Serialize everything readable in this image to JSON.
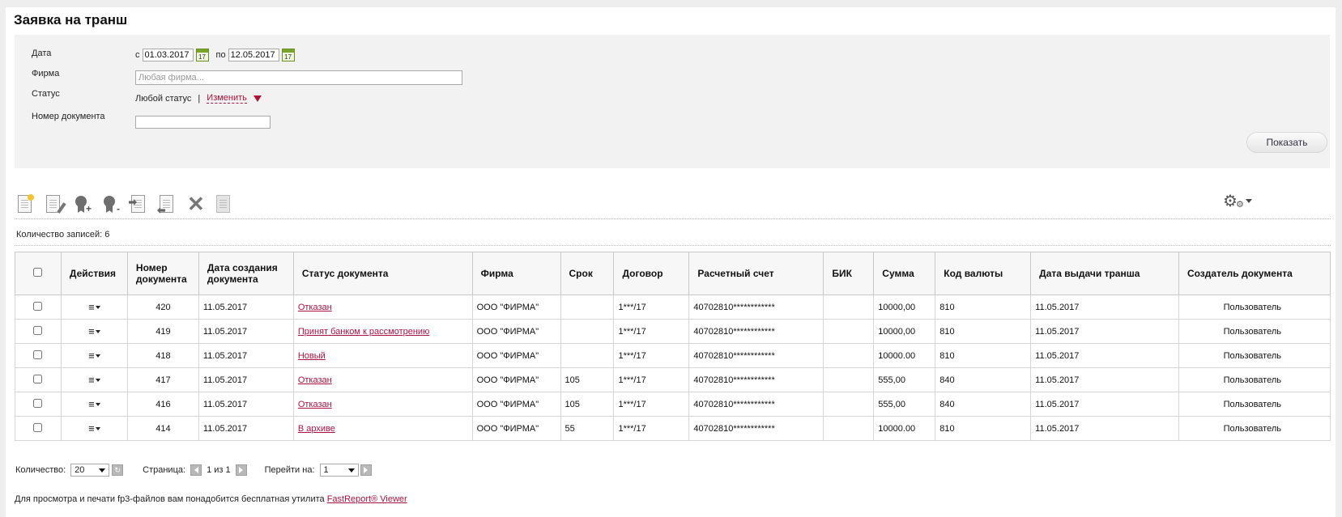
{
  "page": {
    "title": "Заявка на транш"
  },
  "filter": {
    "date_label": "Дата",
    "from_prefix": "с",
    "date_from": "01.03.2017",
    "to_prefix": "по",
    "date_to": "12.05.2017",
    "calendar_day": "17",
    "firm_label": "Фирма",
    "firm_placeholder": "Любая фирма...",
    "status_label": "Статус",
    "status_value": "Любой статус",
    "separator": "|",
    "change_label": "Изменить",
    "docnum_label": "Номер документа",
    "docnum_value": "",
    "show_button": "Показать"
  },
  "toolbar": {
    "icons": [
      "new-document-icon",
      "edit-document-icon",
      "sign-add-icon",
      "sign-icon",
      "send-icon",
      "recall-icon",
      "delete-icon",
      "print-icon"
    ],
    "settings_icon": "gear-icon"
  },
  "records": {
    "label": "Количество записей:",
    "count": "6"
  },
  "table": {
    "headers": {
      "actions": "Действия",
      "number": "Номер документа",
      "created": "Дата создания документа",
      "status": "Статус документа",
      "firm": "Фирма",
      "term": "Срок",
      "contract": "Договор",
      "account": "Расчетный счет",
      "bik": "БИК",
      "sum": "Сумма",
      "currency": "Код валюты",
      "issue_date": "Дата выдачи транша",
      "creator": "Создатель документа"
    },
    "rows": [
      {
        "number": "420",
        "created": "11.05.2017",
        "status": "Отказан",
        "firm": "ООО \"ФИРМА\"",
        "term": "",
        "contract": "1***/17",
        "account": "40702810************",
        "bik": "",
        "sum": "10000,00",
        "currency": "810",
        "issue_date": "11.05.2017",
        "creator": "Пользователь"
      },
      {
        "number": "419",
        "created": "11.05.2017",
        "status": "Принят банком к рассмотрению",
        "firm": "ООО \"ФИРМА\"",
        "term": "",
        "contract": "1***/17",
        "account": "40702810************",
        "bik": "",
        "sum": "10000,00",
        "currency": "810",
        "issue_date": "11.05.2017",
        "creator": "Пользователь"
      },
      {
        "number": "418",
        "created": "11.05.2017",
        "status": "Новый",
        "firm": "ООО \"ФИРМА\"",
        "term": "",
        "contract": "1***/17",
        "account": "40702810************",
        "bik": "",
        "sum": "10000.00",
        "currency": "810",
        "issue_date": "11.05.2017",
        "creator": "Пользователь"
      },
      {
        "number": "417",
        "created": "11.05.2017",
        "status": "Отказан",
        "firm": "ООО \"ФИРМА\"",
        "term": "105",
        "contract": "1***/17",
        "account": "40702810************",
        "bik": "",
        "sum": "555,00",
        "currency": "840",
        "issue_date": "11.05.2017",
        "creator": "Пользователь"
      },
      {
        "number": "416",
        "created": "11.05.2017",
        "status": "Отказан",
        "firm": "ООО \"ФИРМА\"",
        "term": "105",
        "contract": "1***/17",
        "account": "40702810************",
        "bik": "",
        "sum": "555,00",
        "currency": "840",
        "issue_date": "11.05.2017",
        "creator": "Пользователь"
      },
      {
        "number": "414",
        "created": "11.05.2017",
        "status": "В архиве",
        "firm": "ООО \"ФИРМА\"",
        "term": "55",
        "contract": "1***/17",
        "account": "40702810************",
        "bik": "",
        "sum": "10000.00",
        "currency": "810",
        "issue_date": "11.05.2017",
        "creator": "Пользователь"
      }
    ]
  },
  "pager": {
    "quantity_label": "Количество:",
    "quantity_value": "20",
    "page_label": "Страница:",
    "page_text": "1 из 1",
    "goto_label": "Перейти на:",
    "goto_value": "1"
  },
  "footer": {
    "note": "Для просмотра и печати fp3-файлов вам понадобится бесплатная утилита",
    "link": "FastReport® Viewer"
  },
  "colors": {
    "link": "#b0123f",
    "panel": "#f2f2f2",
    "header_bg": "#f7f7f7"
  }
}
